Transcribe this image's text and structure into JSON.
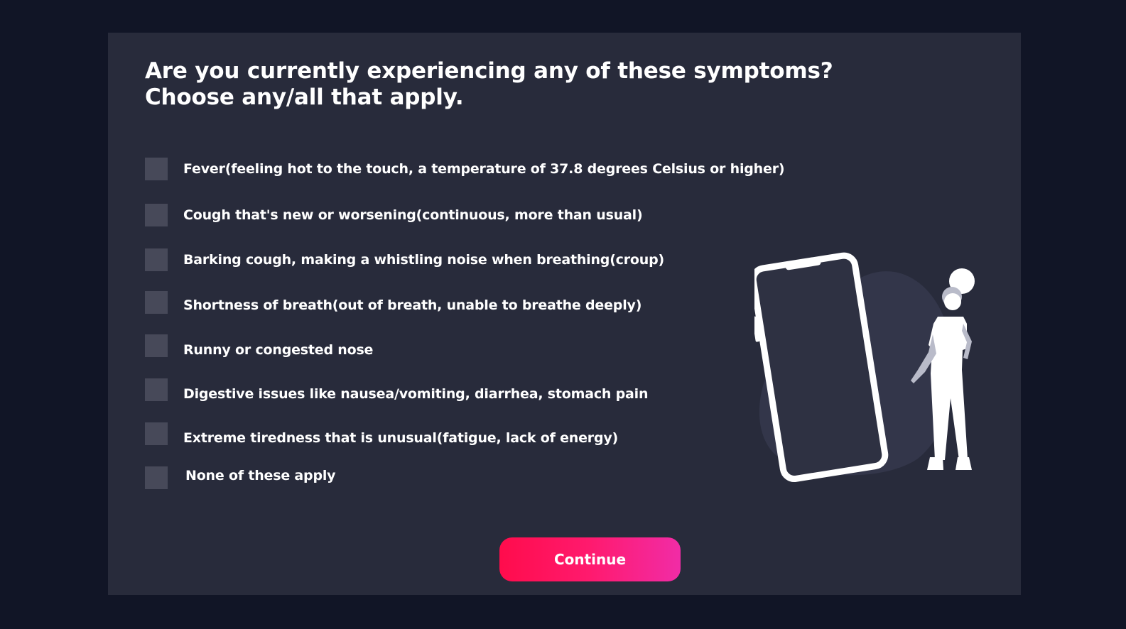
{
  "question": {
    "line1": "Are you currently experiencing any of these symptoms?",
    "line2": "Choose any/all that apply."
  },
  "options": [
    {
      "label": "Fever(feeling hot to the touch, a temperature of 37.8 degrees Celsius or higher)",
      "checked": false
    },
    {
      "label": "Cough that's new or worsening(continuous, more than usual)",
      "checked": false
    },
    {
      "label": "Barking cough, making a whistling noise when breathing(croup)",
      "checked": false
    },
    {
      "label": "Shortness of breath(out of breath, unable to breathe deeply)",
      "checked": false
    },
    {
      "label": "Runny or congested nose",
      "checked": false
    },
    {
      "label": "Digestive issues like nausea/vomiting, diarrhea, stomach pain",
      "checked": false
    },
    {
      "label": "Extreme tiredness that is unusual(fatigue, lack of energy)",
      "checked": false
    },
    {
      "label": "None of these apply",
      "checked": false
    }
  ],
  "continue_button": {
    "label": "Continue"
  },
  "illustration": {
    "icon": "person-with-phone-icon"
  },
  "colors": {
    "background": "#111526",
    "panel": "#282b3b",
    "checkbox": "#474959",
    "accent_start": "#ff0c4c",
    "accent_end": "#f12ca6",
    "text": "#ffffff"
  }
}
